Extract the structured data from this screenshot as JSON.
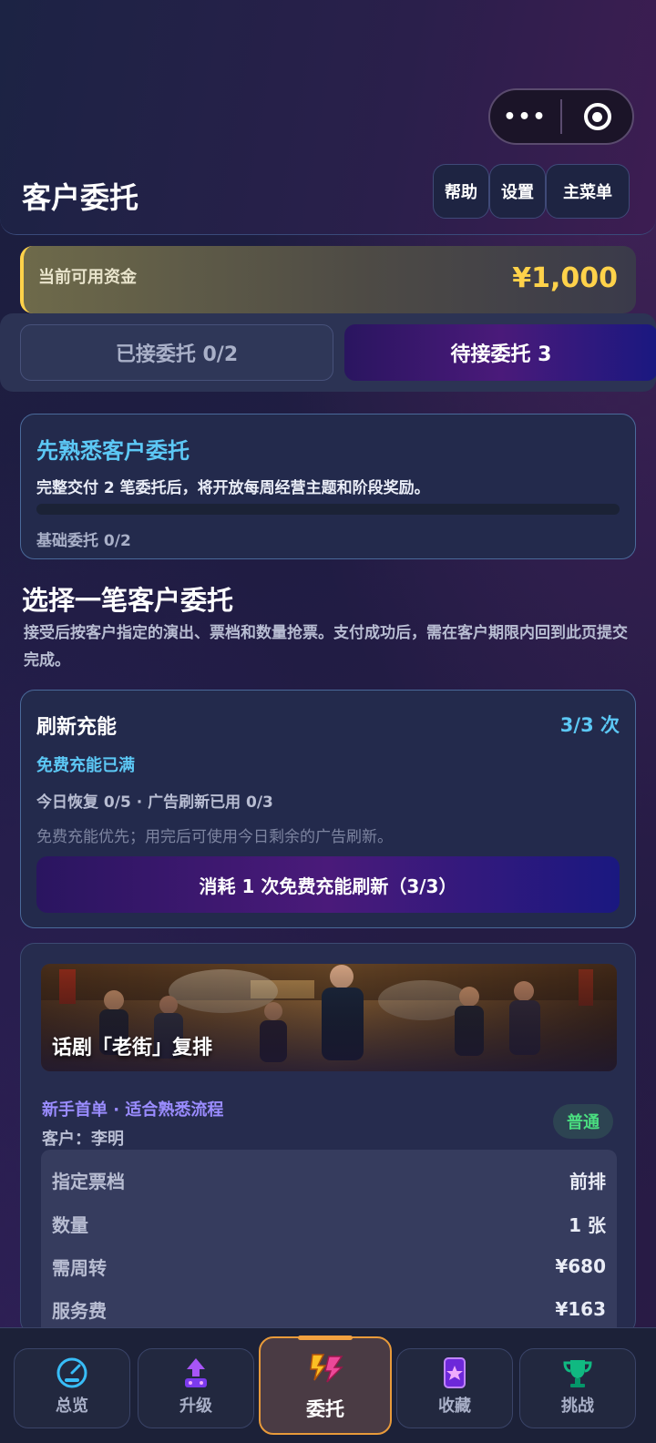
{
  "header": {
    "title": "客户委托",
    "more_icon": "•••",
    "help_label": "帮助",
    "settings_label": "设置",
    "main_menu_label": "主菜单"
  },
  "funds": {
    "label": "当前可用资金",
    "value": "¥1,000",
    "accent_color": "#ffd24a"
  },
  "tabs": [
    {
      "label": "已接委托 0/2",
      "active": false
    },
    {
      "label": "待接委托 3",
      "active": true
    }
  ],
  "intro": {
    "title": "先熟悉客户委托",
    "description": "完整交付 2 笔委托后，将开放每周经营主题和阶段奖励。",
    "progress_label": "基础委托 0/2",
    "progress_fraction": 0
  },
  "section": {
    "title": "选择一笔客户委托",
    "description": "接受后按客户指定的演出、票档和数量抢票。支付成功后，需在客户期限内回到此页提交完成。"
  },
  "refresh": {
    "title": "刷新充能",
    "count": "3/3 次",
    "status": "免费充能已满",
    "stats": "今日恢复 0/5 · 广告刷新已用 0/3",
    "note": "免费充能优先；用完后可使用今日剩余的广告刷新。",
    "button_label": "消耗 1 次免费充能刷新（3/3）"
  },
  "commission": {
    "banner_title": "话剧「老街」复排",
    "tag": "新手首单 · 适合熟悉流程",
    "client": "客户：李明",
    "badge": "普通",
    "details": [
      {
        "key": "指定票档",
        "value": "前排"
      },
      {
        "key": "数量",
        "value": "1 张"
      },
      {
        "key": "需周转",
        "value": "¥680"
      },
      {
        "key": "服务费",
        "value": "¥163"
      }
    ]
  },
  "nav": [
    {
      "label": "总览",
      "icon": "gauge-icon",
      "active": false
    },
    {
      "label": "升级",
      "icon": "upgrade-arrow-icon",
      "active": false
    },
    {
      "label": "委托",
      "icon": "lightning-commission-icon",
      "active": true
    },
    {
      "label": "收藏",
      "icon": "star-card-icon",
      "active": false
    },
    {
      "label": "挑战",
      "icon": "trophy-icon",
      "active": false
    }
  ]
}
